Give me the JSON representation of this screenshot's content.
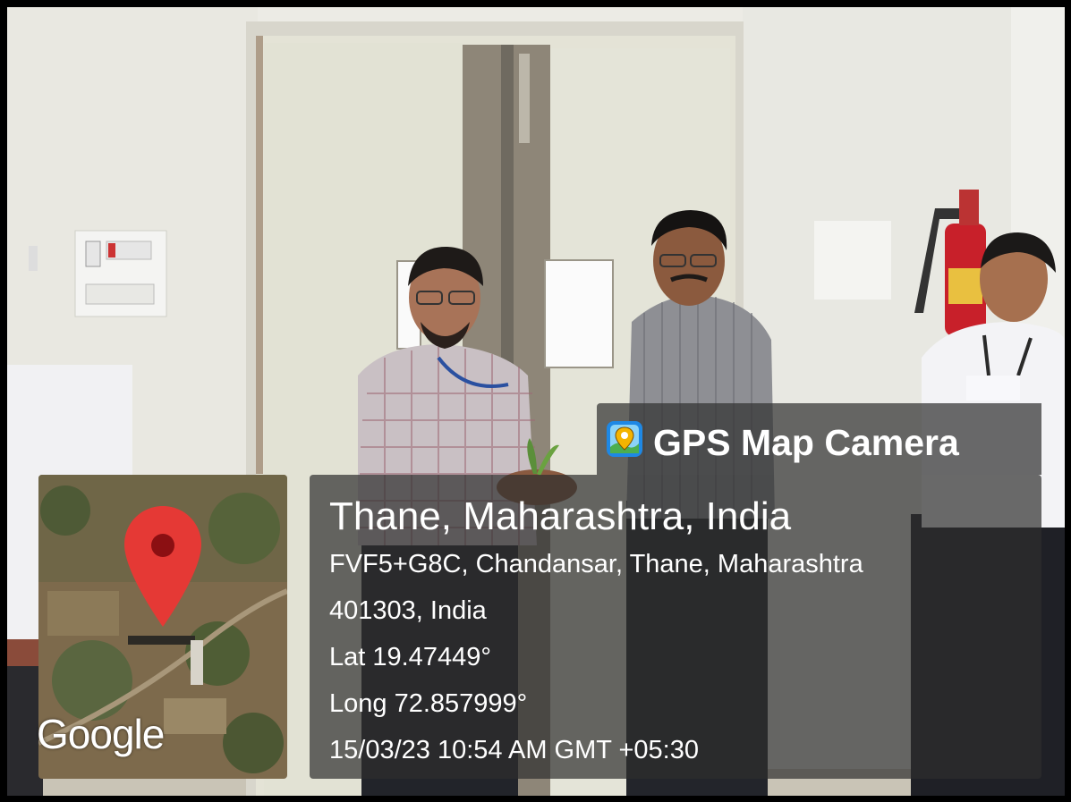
{
  "overlay": {
    "app_name": "GPS Map Camera",
    "icon": "map-camera-icon",
    "location_title": "Thane, Maharashtra, India",
    "address_line1": "FVF5+G8C, Chandansar, Thane, Maharashtra",
    "address_line2": "401303, India",
    "latitude": "Lat 19.47449°",
    "longitude": "Long 72.857999°",
    "timestamp": "15/03/23 10:54 AM GMT +05:30"
  },
  "map": {
    "provider_label": "Google",
    "marker": "map-pin-icon",
    "pin_color": "#e53935"
  },
  "scene": {
    "description_colors": {
      "wall": "#eceae3",
      "door": "#e6e6d8",
      "extinguisher": "#c8202a"
    }
  }
}
